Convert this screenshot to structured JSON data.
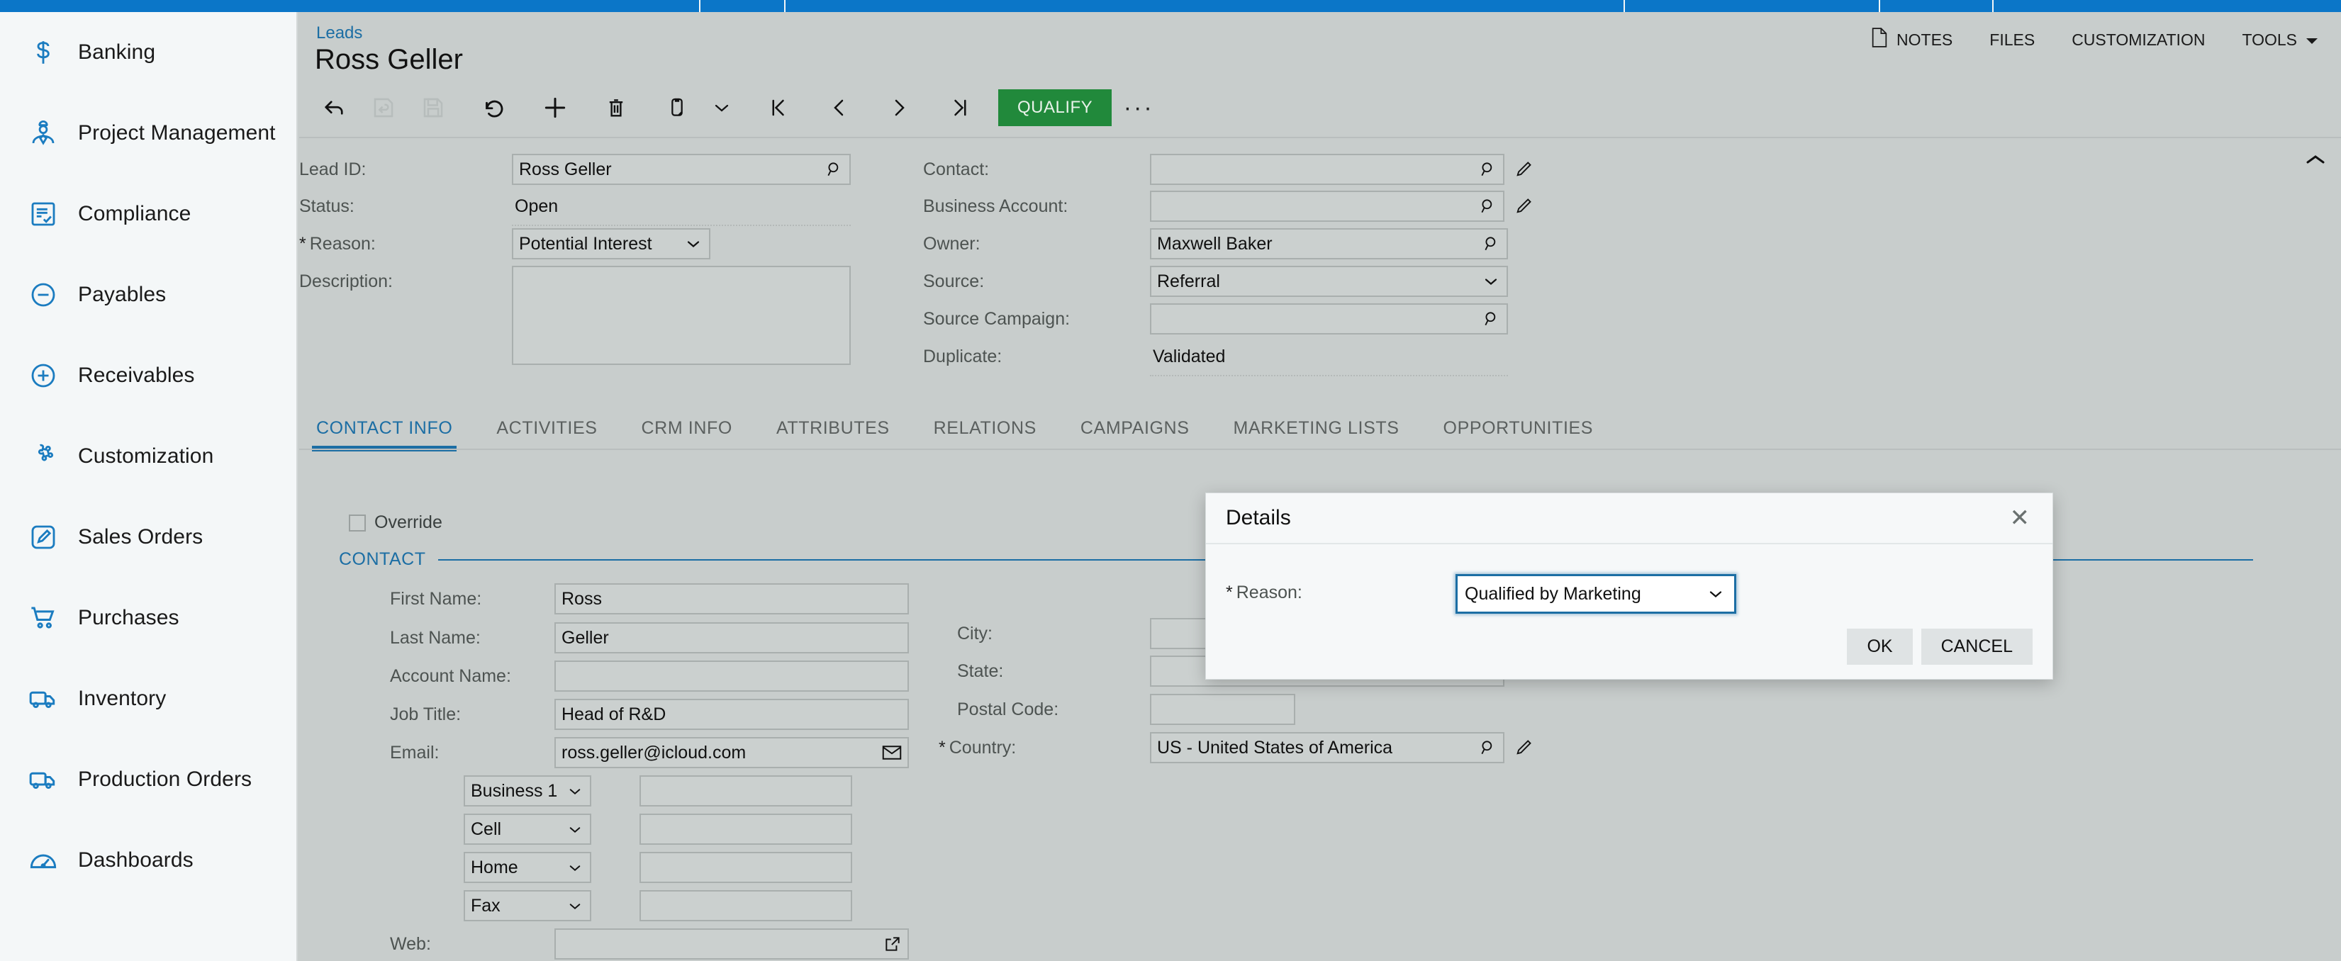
{
  "sidebar": {
    "items": [
      {
        "label": "Banking",
        "icon": "dollar-icon"
      },
      {
        "label": "Project Management",
        "icon": "worker-icon"
      },
      {
        "label": "Compliance",
        "icon": "checklist-icon"
      },
      {
        "label": "Payables",
        "icon": "minus-circle-icon"
      },
      {
        "label": "Receivables",
        "icon": "plus-circle-icon"
      },
      {
        "label": "Customization",
        "icon": "puzzle-icon"
      },
      {
        "label": "Sales Orders",
        "icon": "pencil-square-icon"
      },
      {
        "label": "Purchases",
        "icon": "cart-icon"
      },
      {
        "label": "Inventory",
        "icon": "truck-icon"
      },
      {
        "label": "Production Orders",
        "icon": "truck-icon"
      },
      {
        "label": "Dashboards",
        "icon": "gauge-icon"
      }
    ]
  },
  "header": {
    "breadcrumb": "Leads",
    "title": "Ross Geller",
    "right_items": [
      {
        "label": "NOTES",
        "icon": "note-icon"
      },
      {
        "label": "FILES",
        "icon": ""
      },
      {
        "label": "CUSTOMIZATION",
        "icon": ""
      },
      {
        "label": "TOOLS",
        "icon": "chevron-down-icon"
      }
    ]
  },
  "toolbar": {
    "buttons": [
      {
        "name": "back",
        "icon": "arrow-left-icon",
        "disabled": false
      },
      {
        "name": "save-and-close",
        "icon": "save-close-icon",
        "disabled": true
      },
      {
        "name": "save",
        "icon": "floppy-icon",
        "disabled": true
      },
      {
        "name": "undo",
        "icon": "undo-icon",
        "disabled": false
      },
      {
        "name": "add-new",
        "icon": "plus-icon",
        "disabled": false
      },
      {
        "name": "delete",
        "icon": "trash-icon",
        "disabled": false
      },
      {
        "name": "copy-paste",
        "icon": "clipboard-icon",
        "disabled": false
      },
      {
        "name": "copy-paste-menu",
        "icon": "chevron-down-icon",
        "disabled": false
      },
      {
        "name": "first-record",
        "icon": "first-icon",
        "disabled": false
      },
      {
        "name": "prev-record",
        "icon": "chevron-left-icon",
        "disabled": false
      },
      {
        "name": "next-record",
        "icon": "chevron-right-icon",
        "disabled": false
      },
      {
        "name": "last-record",
        "icon": "last-icon",
        "disabled": false
      }
    ],
    "qualify_label": "QUALIFY",
    "qualify_color": "#21893b",
    "more_label": "···"
  },
  "summary": {
    "left": [
      {
        "label": "Lead ID:",
        "value": "Ross Geller",
        "type": "lookup",
        "required": false
      },
      {
        "label": "Status:",
        "value": "Open",
        "type": "text",
        "required": false
      },
      {
        "label": "Reason:",
        "value": "Potential Interest",
        "type": "select",
        "required": true
      },
      {
        "label": "Description:",
        "value": "",
        "type": "textarea",
        "required": false
      }
    ],
    "right": [
      {
        "label": "Contact:",
        "value": "",
        "type": "lookup-edit",
        "required": false
      },
      {
        "label": "Business Account:",
        "value": "",
        "type": "lookup-edit",
        "required": false
      },
      {
        "label": "Owner:",
        "value": "Maxwell Baker",
        "type": "lookup",
        "required": false
      },
      {
        "label": "Source:",
        "value": "Referral",
        "type": "select",
        "required": false
      },
      {
        "label": "Source Campaign:",
        "value": "",
        "type": "lookup",
        "required": false
      },
      {
        "label": "Duplicate:",
        "value": "Validated",
        "type": "text",
        "required": false
      }
    ]
  },
  "tabs": [
    {
      "label": "CONTACT INFO",
      "active": true
    },
    {
      "label": "ACTIVITIES",
      "active": false
    },
    {
      "label": "CRM INFO",
      "active": false
    },
    {
      "label": "ATTRIBUTES",
      "active": false
    },
    {
      "label": "RELATIONS",
      "active": false
    },
    {
      "label": "CAMPAIGNS",
      "active": false
    },
    {
      "label": "MARKETING LISTS",
      "active": false
    },
    {
      "label": "OPPORTUNITIES",
      "active": false
    }
  ],
  "contact_tab": {
    "override_label": "Override",
    "override_checked": false,
    "group_title": "CONTACT",
    "fields": [
      {
        "label": "First Name:",
        "value": "Ross",
        "type": "text"
      },
      {
        "label": "Last Name:",
        "value": "Geller",
        "type": "text"
      },
      {
        "label": "Account Name:",
        "value": "",
        "type": "text"
      },
      {
        "label": "Job Title:",
        "value": "Head of R&D",
        "type": "text"
      },
      {
        "label": "Email:",
        "value": "ross.geller@icloud.com",
        "type": "email"
      }
    ],
    "phones": [
      {
        "type": "Business 1",
        "value": ""
      },
      {
        "type": "Cell",
        "value": ""
      },
      {
        "type": "Home",
        "value": ""
      },
      {
        "type": "Fax",
        "value": ""
      }
    ],
    "web": {
      "label": "Web:",
      "value": ""
    },
    "address": [
      {
        "label": "City:",
        "value": "",
        "type": "text",
        "required": false
      },
      {
        "label": "State:",
        "value": "",
        "type": "lookup",
        "required": false
      },
      {
        "label": "Postal Code:",
        "value": "",
        "type": "text-short",
        "required": false
      },
      {
        "label": "Country:",
        "value": "US - United States of America",
        "type": "lookup-edit",
        "required": true
      }
    ]
  },
  "modal": {
    "title": "Details",
    "close_label": "✕",
    "reason_label": "Reason:",
    "reason_required": true,
    "reason_value": "Qualified by Marketing",
    "ok_label": "OK",
    "cancel_label": "CANCEL",
    "focus_color": "#1c6ea4"
  },
  "theme": {
    "accent": "#1c6ea4",
    "brand_blue": "#0b76c8",
    "page_bg": "#c8cdcc",
    "sidebar_bg": "#f4f7f8",
    "success": "#21893b"
  }
}
